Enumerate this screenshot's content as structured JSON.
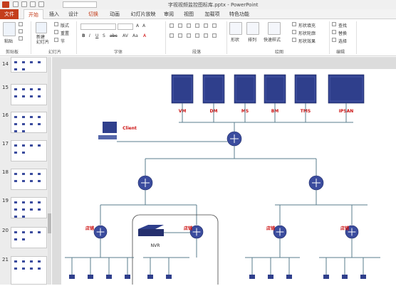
{
  "window": {
    "title": "字视视频监控图标库.pptx - PowerPoint"
  },
  "tabs": [
    "文件",
    "开始",
    "插入",
    "设计",
    "切换",
    "动画",
    "幻灯片放映",
    "审阅",
    "视图",
    "加载项",
    "特色功能"
  ],
  "ribbon": {
    "clipboard": {
      "paste": "粘贴",
      "label": "剪贴板"
    },
    "slides": {
      "new_slide": "新建\n幻灯片",
      "layout": "版式",
      "reset": "重置",
      "section": "节",
      "label": "幻灯片"
    },
    "font": {
      "label": "字体"
    },
    "paragraph": {
      "label": "段落"
    },
    "drawing": {
      "shapes": "形状",
      "arrange": "排列",
      "quick_styles": "快速样式",
      "fill": "形状填充",
      "outline": "形状轮廓",
      "effects": "形状效果",
      "label": "绘图"
    },
    "editing": {
      "find": "查找",
      "replace": "替换",
      "select": "选择",
      "label": "编辑"
    }
  },
  "thumbnails": [
    {
      "num": "14"
    },
    {
      "num": "15"
    },
    {
      "num": "16"
    },
    {
      "num": "17"
    },
    {
      "num": "18"
    },
    {
      "num": "19"
    },
    {
      "num": "20"
    },
    {
      "num": "21"
    }
  ],
  "diagram": {
    "servers": [
      "VM",
      "DM",
      "MS",
      "BM",
      "TMS",
      "IPSAN"
    ],
    "client": "Client",
    "nvr": "NVR",
    "store_label": "店铺",
    "colors": {
      "server": "#2f3f8c",
      "router": "#3b4c9e",
      "label": "#cc1111",
      "line": "#5a7d8c"
    }
  }
}
